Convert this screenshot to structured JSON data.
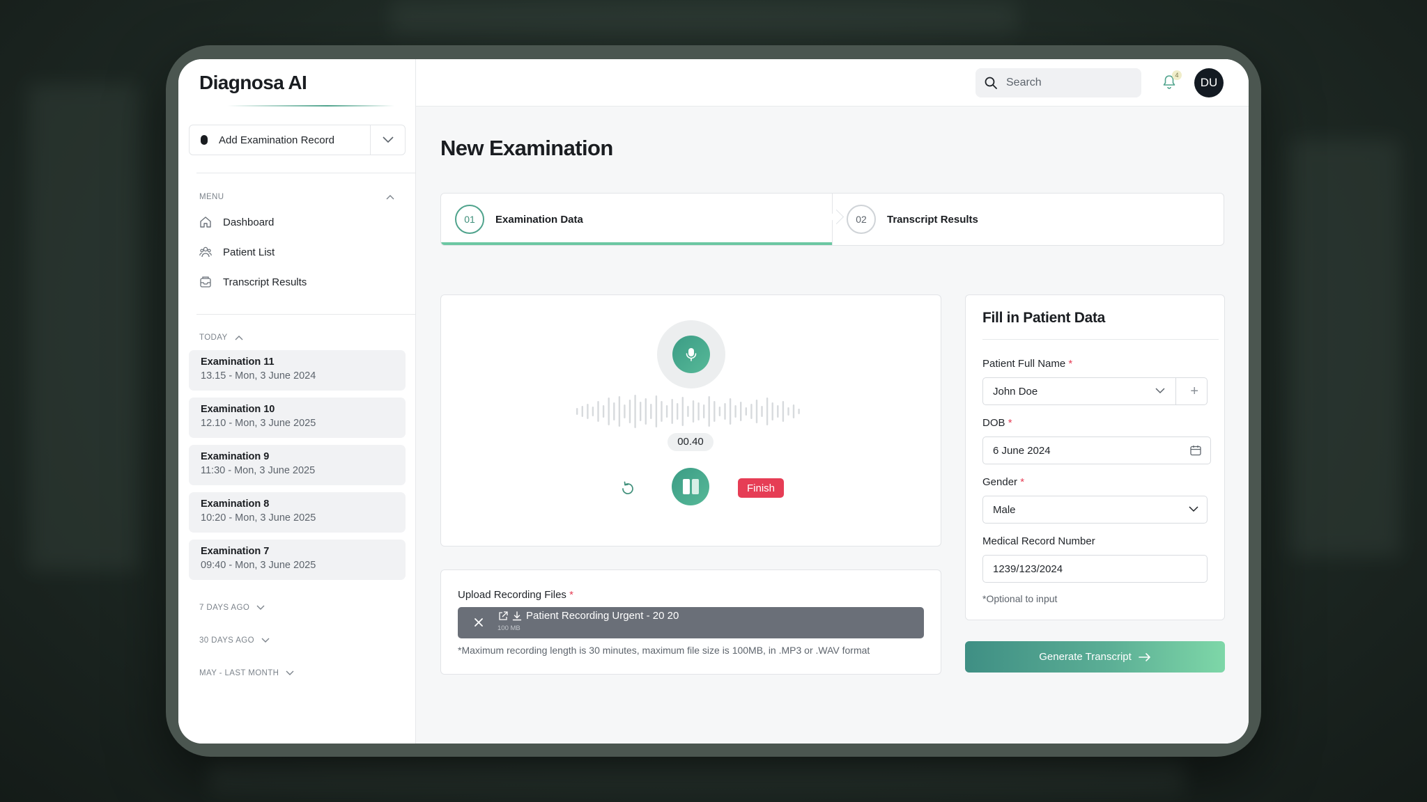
{
  "app": {
    "brand": "Diagnosa AI"
  },
  "sidebar": {
    "add_record_label": "Add Examination Record",
    "menu_label": "MENU",
    "menu_items": [
      {
        "label": "Dashboard",
        "icon": "home-icon"
      },
      {
        "label": "Patient List",
        "icon": "users-icon"
      },
      {
        "label": "Transcript Results",
        "icon": "inbox-icon"
      }
    ],
    "today_label": "TODAY",
    "examinations": [
      {
        "title": "Examination 11",
        "subtitle": "13.15 - Mon, 3 June 2024"
      },
      {
        "title": "Examination 10",
        "subtitle": "12.10 - Mon, 3 June 2025"
      },
      {
        "title": "Examination 9",
        "subtitle": "11:30 - Mon, 3 June 2025"
      },
      {
        "title": "Examination 8",
        "subtitle": "10:20 - Mon, 3 June 2025"
      },
      {
        "title": "Examination 7",
        "subtitle": "09:40 - Mon, 3 June 2025"
      }
    ],
    "groups": [
      "7 DAYS AGO",
      "30 DAYS AGO",
      "MAY - LAST MONTH"
    ]
  },
  "topbar": {
    "search_placeholder": "Search",
    "notification_count": "4",
    "avatar_initials": "DU"
  },
  "page": {
    "title": "New Examination",
    "steps": [
      {
        "number": "01",
        "label": "Examination Data",
        "active": true
      },
      {
        "number": "02",
        "label": "Transcript Results",
        "active": false
      }
    ]
  },
  "recorder": {
    "timer": "00.40",
    "finish_label": "Finish"
  },
  "upload": {
    "label": "Upload Recording Files",
    "required_mark": "*",
    "file_name": "Patient Recording Urgent - 20 20",
    "file_size": "100 MB",
    "note": "*Maximum recording length is 30 minutes, maximum file size is 100MB, in .MP3 or .WAV format"
  },
  "patient_form": {
    "title": "Fill in Patient Data",
    "name_label": "Patient Full Name",
    "name_value": "John Doe",
    "dob_label": "DOB",
    "dob_value": "6 June 2024",
    "gender_label": "Gender",
    "gender_value": "Male",
    "mrn_label": "Medical Record Number",
    "mrn_value": "1239/123/2024",
    "optional_note": "*Optional to input",
    "required_mark": "*"
  },
  "actions": {
    "generate_label": "Generate Transcript"
  },
  "colors": {
    "accent": "#4fa38c",
    "danger": "#e63d55",
    "dark": "#131a22"
  }
}
